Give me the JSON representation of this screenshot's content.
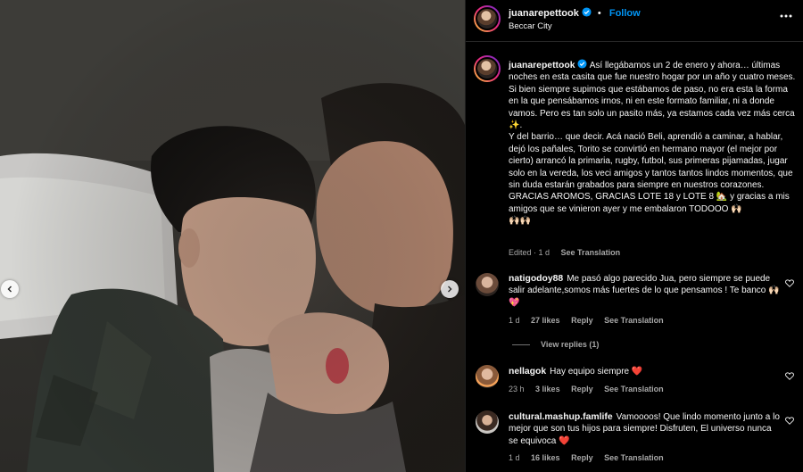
{
  "post": {
    "username": "juanarepettook",
    "follow_label": "Follow",
    "location": "Beccar City",
    "caption": "Así llegábamos un 2 de enero y ahora… últimas noches en esta casita que fue nuestro hogar por un año y cuatro meses. Si bien siempre supimos que estábamos de paso, no era esta la forma en la que pensábamos irnos, ni en este formato familiar, ni a donde vamos. Pero es tan solo un pasito más, ya estamos cada vez más cerca ✨.\nY del barrio… que decir. Acá nació Beli, aprendió a caminar, a hablar, dejó los pañales, Torito se convirtió en hermano mayor (el mejor por cierto) arrancó la primaria, rugby, futbol, sus primeras pijamadas, jugar solo en la vereda, los veci amigos y tantos tantos lindos momentos, que sin duda estarán grabados para siempre en nuestros corazones.\nGRACIAS AROMOS, GRACIAS LOTE 18 y LOTE 8 🏡 y gracias a mis amigos que se vinieron ayer y me embalaron TODOOO 🙌🏻\n🙌🏻🙌🏻",
    "edited": "Edited · 1 d",
    "see_translation": "See Translation"
  },
  "comments": [
    {
      "username": "natigodoy88",
      "text": "Me pasó algo parecido Jua, pero siempre se puede salir adelante,somos más fuertes de lo que pensamos ! Te banco 🙌🏻💖",
      "time": "1 d",
      "likes": "27 likes",
      "reply": "Reply",
      "translate": "See Translation"
    },
    {
      "username": "nellagok",
      "text": "Hay equipo siempre ❤️",
      "time": "23 h",
      "likes": "3 likes",
      "reply": "Reply",
      "translate": "See Translation"
    },
    {
      "username": "cultural.mashup.famlife",
      "text": "Vamoooos! Que lindo momento junto a lo mejor que son tus hijos para siempre! Disfruten, El universo nunca se equivoca ❤️",
      "time": "1 d",
      "likes": "16 likes",
      "reply": "Reply",
      "translate": "See Translation"
    }
  ],
  "view_replies": "View replies (1)",
  "colors": {
    "background": "#000000",
    "text": "#f5f5f5",
    "muted": "#a8a8a8",
    "follow": "#0095f6",
    "verified": "#0095f6"
  },
  "icons": {
    "verified": "verified-badge-icon",
    "more": "more-options-icon",
    "heart": "heart-icon",
    "prev": "chevron-left-icon",
    "next": "chevron-right-icon"
  }
}
